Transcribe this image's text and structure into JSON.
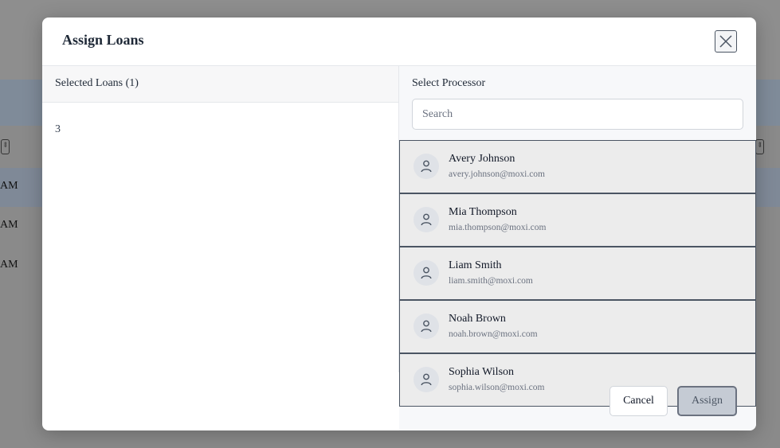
{
  "background": {
    "row_time_suffixes": [
      "AM",
      "AM",
      "AM"
    ]
  },
  "modal": {
    "title": "Assign Loans",
    "close_icon": "close-icon"
  },
  "selected_loans": {
    "heading": "Selected Loans (1)",
    "items": [
      "3"
    ]
  },
  "processor": {
    "heading": "Select Processor",
    "search_placeholder": "Search",
    "search_value": "",
    "avatar_icon": "user-icon",
    "items": [
      {
        "name": "Avery Johnson",
        "email": "avery.johnson@moxi.com"
      },
      {
        "name": "Mia Thompson",
        "email": "mia.thompson@moxi.com"
      },
      {
        "name": "Liam Smith",
        "email": "liam.smith@moxi.com"
      },
      {
        "name": "Noah Brown",
        "email": "noah.brown@moxi.com"
      },
      {
        "name": "Sophia Wilson",
        "email": "sophia.wilson@moxi.com"
      }
    ]
  },
  "footer": {
    "cancel_label": "Cancel",
    "assign_label": "Assign",
    "assign_disabled": true
  },
  "colors": {
    "overlay": "#8a8a8a",
    "modal_bg": "#ffffff",
    "list_item_bg": "#ececec",
    "assign_disabled_bg": "#c5cbd4"
  }
}
